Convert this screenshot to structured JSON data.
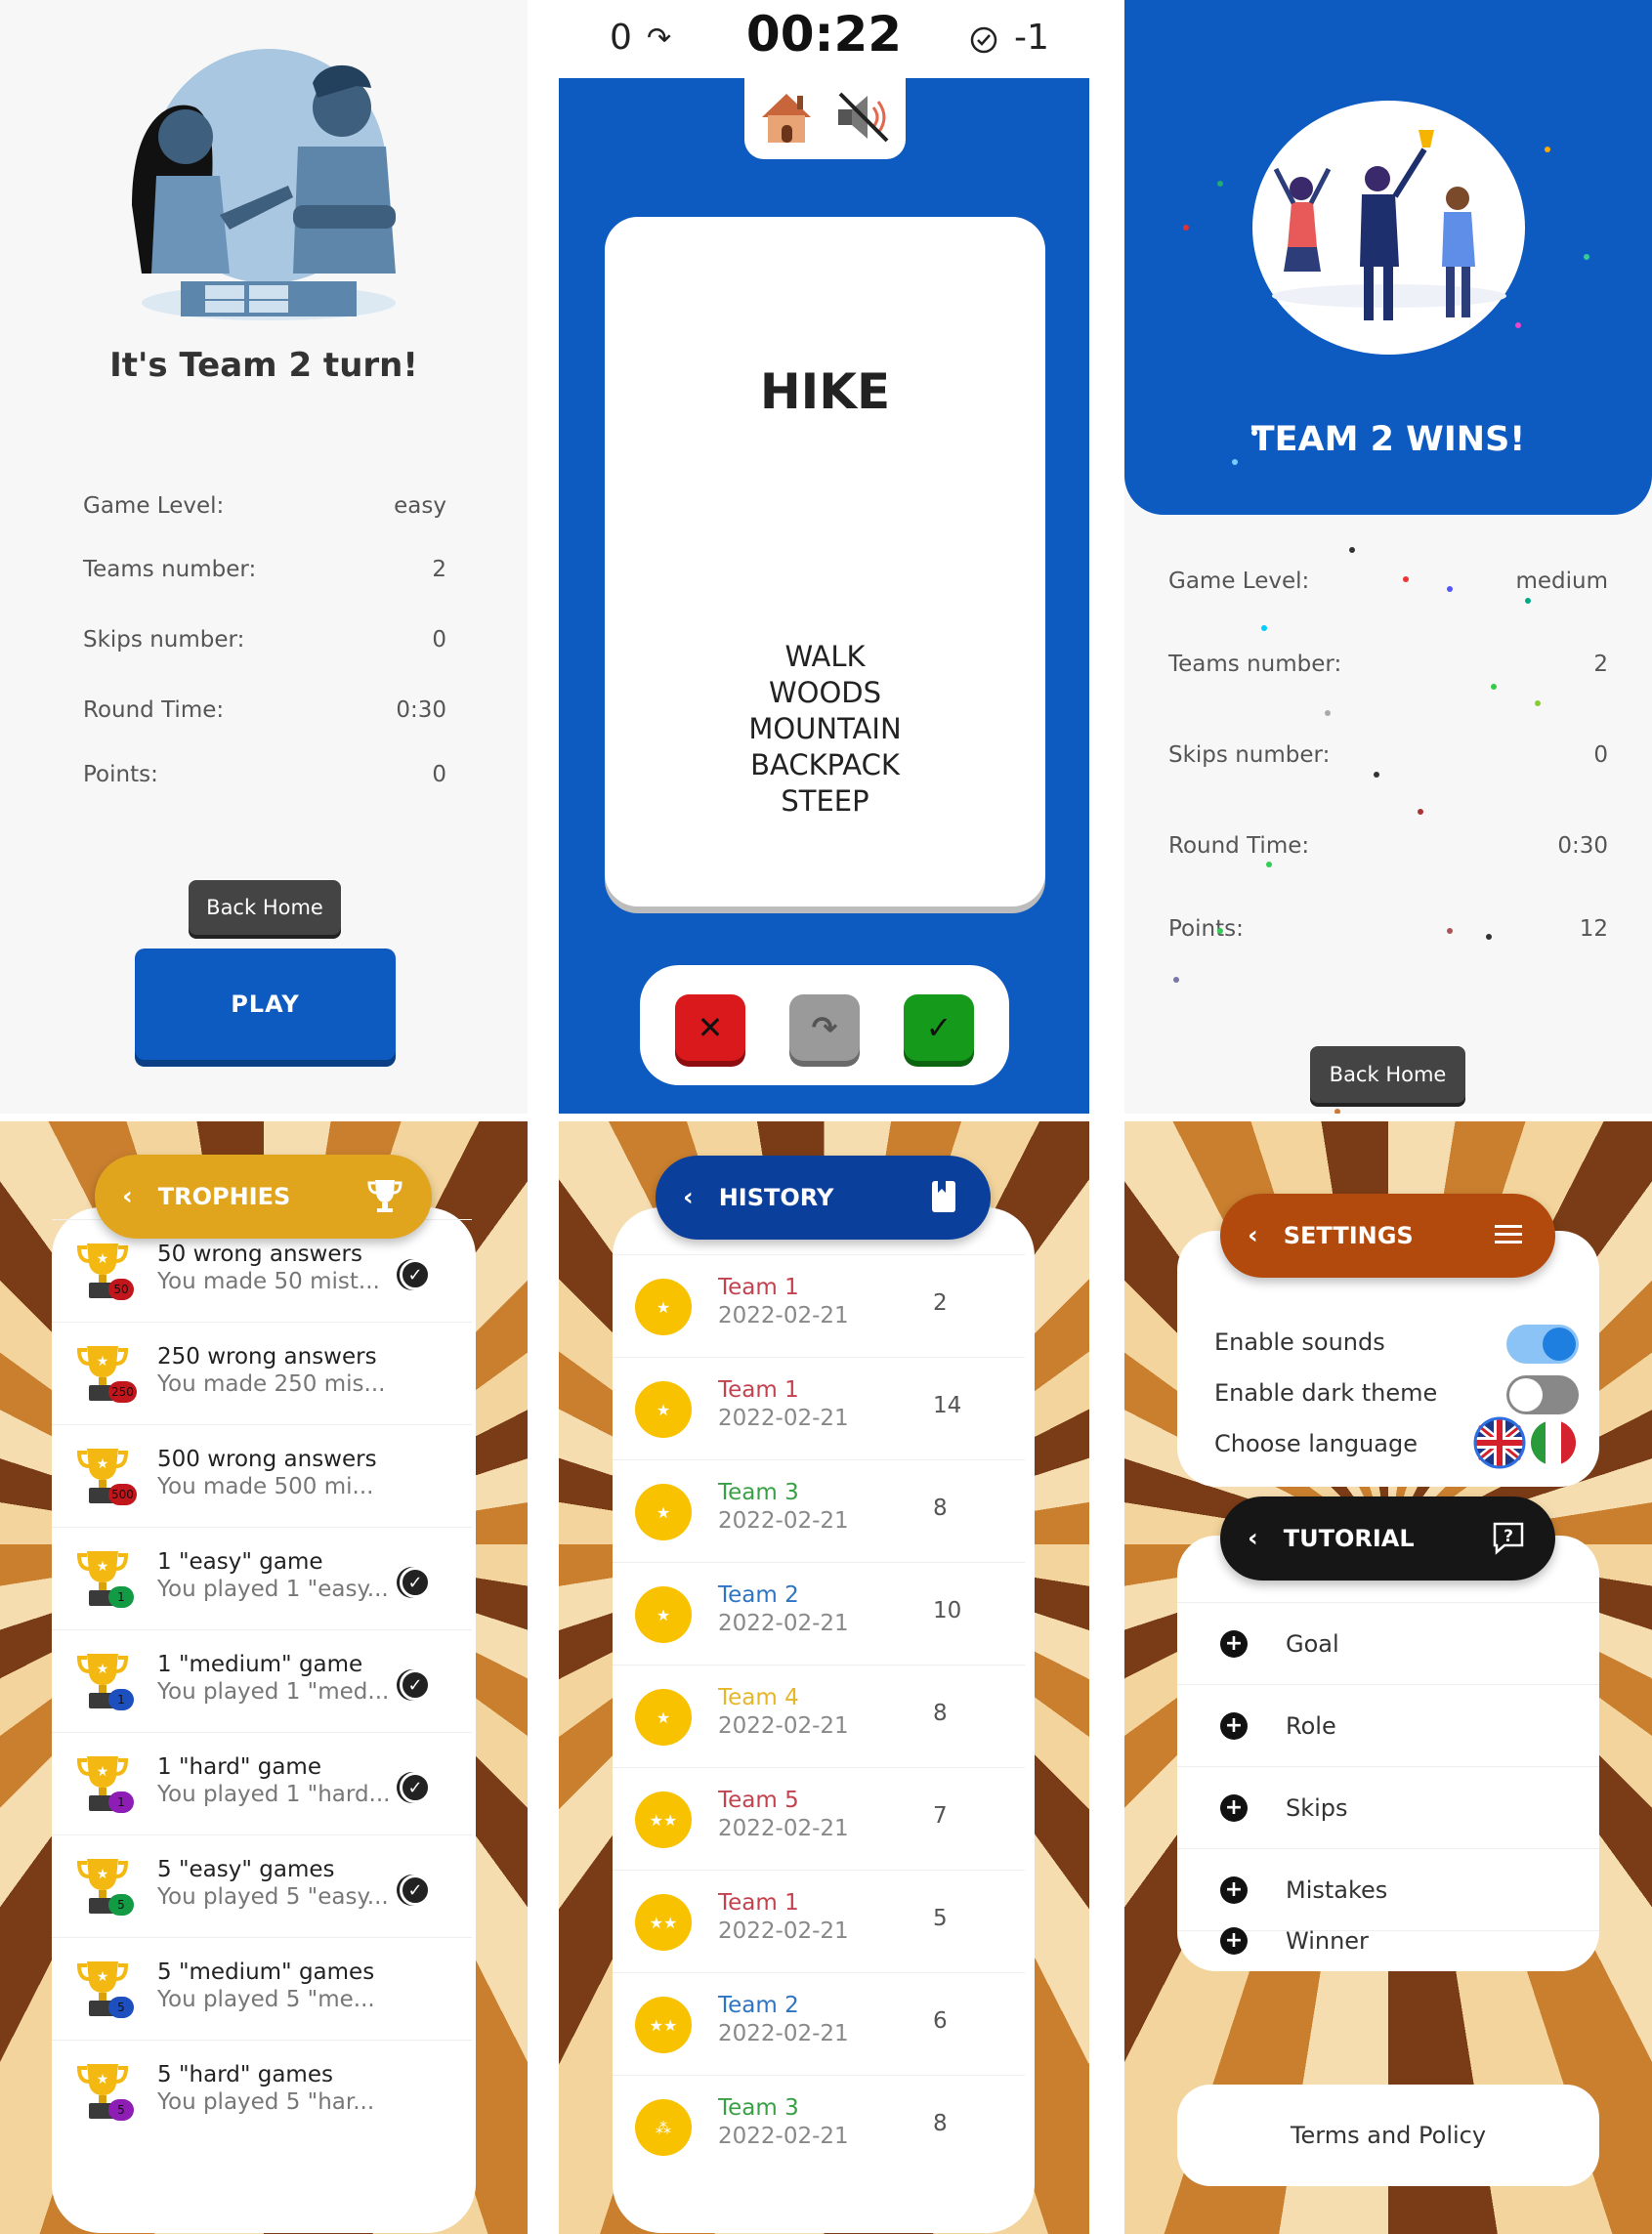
{
  "turn_screen": {
    "title": "It's Team 2 turn!",
    "stats": [
      {
        "label": "Game Level:",
        "value": "easy"
      },
      {
        "label": "Teams number:",
        "value": "2"
      },
      {
        "label": "Skips number:",
        "value": "0"
      },
      {
        "label": "Round Time:",
        "value": "0:30"
      },
      {
        "label": "Points:",
        "value": "0"
      }
    ],
    "back_home": "Back Home",
    "play": "PLAY"
  },
  "game_screen": {
    "skips_count": "0",
    "timer": "00:22",
    "score": "-1",
    "word": "HIKE",
    "taboo_words": [
      "WALK",
      "WOODS",
      "MOUNTAIN",
      "BACKPACK",
      "STEEP"
    ],
    "buttons": {
      "wrong": "✕",
      "skip": "↷",
      "correct": "✓"
    }
  },
  "win_screen": {
    "title": "TEAM 2 WINS!",
    "stats": [
      {
        "label": "Game Level:",
        "value": "medium"
      },
      {
        "label": "Teams number:",
        "value": "2"
      },
      {
        "label": "Skips number:",
        "value": "0"
      },
      {
        "label": "Round Time:",
        "value": "0:30"
      },
      {
        "label": "Points:",
        "value": "12"
      }
    ],
    "back_home": "Back Home"
  },
  "trophies": {
    "header": "TROPHIES",
    "header_color": "#e0a51d",
    "items": [
      {
        "title": "50 wrong answers",
        "desc": "You made 50 mist...",
        "badge": "50",
        "badge_color": "#c0161c",
        "done": true
      },
      {
        "title": "250 wrong answers",
        "desc": "You made 250 mis...",
        "badge": "250",
        "badge_color": "#c0161c",
        "done": false
      },
      {
        "title": "500 wrong answers",
        "desc": "You made 500 mi...",
        "badge": "500",
        "badge_color": "#c0161c",
        "done": false
      },
      {
        "title": "1 \"easy\" game",
        "desc": "You played 1 \"easy...",
        "badge": "1",
        "badge_color": "#129a45",
        "done": true
      },
      {
        "title": "1 \"medium\" game",
        "desc": "You played 1 \"med...",
        "badge": "1",
        "badge_color": "#1e4fbf",
        "done": true
      },
      {
        "title": "1 \"hard\" game",
        "desc": "You played 1 \"hard...",
        "badge": "1",
        "badge_color": "#8e1db5",
        "done": true
      },
      {
        "title": "5 \"easy\" games",
        "desc": "You played 5 \"easy...",
        "badge": "5",
        "badge_color": "#129a45",
        "done": true
      },
      {
        "title": "5 \"medium\" games",
        "desc": "You played 5 \"me...",
        "badge": "5",
        "badge_color": "#1e4fbf",
        "done": false
      },
      {
        "title": "5 \"hard\" games",
        "desc": "You played 5 \"har...",
        "badge": "5",
        "badge_color": "#8e1db5",
        "done": false
      }
    ]
  },
  "history": {
    "header": "HISTORY",
    "header_color": "#0b3f9c",
    "items": [
      {
        "team": "Team 1",
        "date": "2022-02-21",
        "score": "2",
        "color": "#c2434f",
        "coin": "★"
      },
      {
        "team": "Team 1",
        "date": "2022-02-21",
        "score": "14",
        "color": "#c2434f",
        "coin": "★"
      },
      {
        "team": "Team 3",
        "date": "2022-02-21",
        "score": "8",
        "color": "#3aa046",
        "coin": "★"
      },
      {
        "team": "Team 2",
        "date": "2022-02-21",
        "score": "10",
        "color": "#2d74c4",
        "coin": "★"
      },
      {
        "team": "Team 4",
        "date": "2022-02-21",
        "score": "8",
        "color": "#e5b52a",
        "coin": "★"
      },
      {
        "team": "Team 5",
        "date": "2022-02-21",
        "score": "7",
        "color": "#c2434f",
        "coin": "★★"
      },
      {
        "team": "Team 1",
        "date": "2022-02-21",
        "score": "5",
        "color": "#c2434f",
        "coin": "★★"
      },
      {
        "team": "Team 2",
        "date": "2022-02-21",
        "score": "6",
        "color": "#2d74c4",
        "coin": "★★"
      },
      {
        "team": "Team 3",
        "date": "2022-02-21",
        "score": "8",
        "color": "#3aa046",
        "coin": "⁂"
      }
    ]
  },
  "settings": {
    "header": "SETTINGS",
    "header_color": "#b34a0d",
    "enable_sounds": "Enable sounds",
    "sounds_on": true,
    "enable_dark_theme": "Enable dark theme",
    "dark_on": false,
    "choose_language": "Choose language",
    "tutorial_header": "TUTORIAL",
    "tutorial_items": [
      "Goal",
      "Role",
      "Skips",
      "Mistakes",
      "Winner"
    ],
    "terms": "Terms and Policy"
  }
}
